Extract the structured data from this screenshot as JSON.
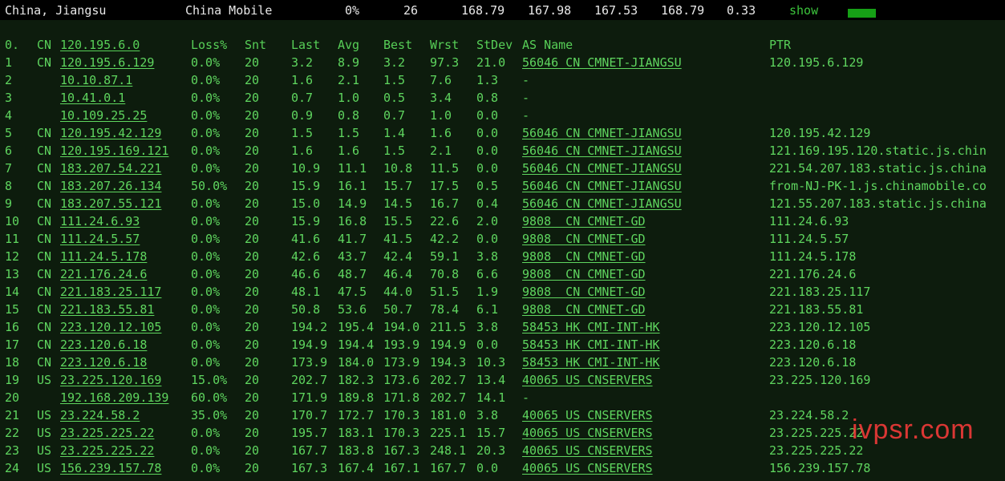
{
  "summary": {
    "location": "China, Jiangsu",
    "isp": "China Mobile",
    "loss": "0%",
    "sent": "26",
    "last": "168.79",
    "avg": "167.98",
    "best": "167.53",
    "worst": "168.79",
    "stdev": "0.33",
    "show_label": "show"
  },
  "headers": {
    "num": "0.",
    "cc": "CN",
    "ip": "120.195.6.0",
    "loss": "Loss%",
    "snt": "Snt",
    "last": "Last",
    "avg": "Avg",
    "best": "Best",
    "wrst": "Wrst",
    "stdev": "StDev",
    "as": "AS Name",
    "ptr": "PTR"
  },
  "hops": [
    {
      "num": "1",
      "cc": "CN",
      "ip": "120.195.6.129",
      "loss": "0.0%",
      "snt": "20",
      "last": "3.2",
      "avg": "8.9",
      "best": "3.2",
      "wrst": "97.3",
      "stdev": "21.0",
      "as": "56046 CN CMNET-JIANGSU",
      "ptr": "120.195.6.129"
    },
    {
      "num": "2",
      "cc": "",
      "ip": "10.10.87.1",
      "loss": "0.0%",
      "snt": "20",
      "last": "1.6",
      "avg": "2.1",
      "best": "1.5",
      "wrst": "7.6",
      "stdev": "1.3",
      "as": "-",
      "ptr": ""
    },
    {
      "num": "3",
      "cc": "",
      "ip": "10.41.0.1",
      "loss": "0.0%",
      "snt": "20",
      "last": "0.7",
      "avg": "1.0",
      "best": "0.5",
      "wrst": "3.4",
      "stdev": "0.8",
      "as": "-",
      "ptr": ""
    },
    {
      "num": "4",
      "cc": "",
      "ip": "10.109.25.25",
      "loss": "0.0%",
      "snt": "20",
      "last": "0.9",
      "avg": "0.8",
      "best": "0.7",
      "wrst": "1.0",
      "stdev": "0.0",
      "as": "-",
      "ptr": ""
    },
    {
      "num": "5",
      "cc": "CN",
      "ip": "120.195.42.129",
      "loss": "0.0%",
      "snt": "20",
      "last": "1.5",
      "avg": "1.5",
      "best": "1.4",
      "wrst": "1.6",
      "stdev": "0.0",
      "as": "56046 CN CMNET-JIANGSU",
      "ptr": "120.195.42.129"
    },
    {
      "num": "6",
      "cc": "CN",
      "ip": "120.195.169.121",
      "loss": "0.0%",
      "snt": "20",
      "last": "1.6",
      "avg": "1.6",
      "best": "1.5",
      "wrst": "2.1",
      "stdev": "0.0",
      "as": "56046 CN CMNET-JIANGSU",
      "ptr": "121.169.195.120.static.js.chin"
    },
    {
      "num": "7",
      "cc": "CN",
      "ip": "183.207.54.221",
      "loss": "0.0%",
      "snt": "20",
      "last": "10.9",
      "avg": "11.1",
      "best": "10.8",
      "wrst": "11.5",
      "stdev": "0.0",
      "as": "56046 CN CMNET-JIANGSU",
      "ptr": "221.54.207.183.static.js.china"
    },
    {
      "num": "8",
      "cc": "CN",
      "ip": "183.207.26.134",
      "loss": "50.0%",
      "snt": "20",
      "last": "15.9",
      "avg": "16.1",
      "best": "15.7",
      "wrst": "17.5",
      "stdev": "0.5",
      "as": "56046 CN CMNET-JIANGSU",
      "ptr": "from-NJ-PK-1.js.chinamobile.co"
    },
    {
      "num": "9",
      "cc": "CN",
      "ip": "183.207.55.121",
      "loss": "0.0%",
      "snt": "20",
      "last": "15.0",
      "avg": "14.9",
      "best": "14.5",
      "wrst": "16.7",
      "stdev": "0.4",
      "as": "56046 CN CMNET-JIANGSU",
      "ptr": "121.55.207.183.static.js.china"
    },
    {
      "num": "10",
      "cc": "CN",
      "ip": "111.24.6.93",
      "loss": "0.0%",
      "snt": "20",
      "last": "15.9",
      "avg": "16.8",
      "best": "15.5",
      "wrst": "22.6",
      "stdev": "2.0",
      "as": "9808  CN CMNET-GD",
      "ptr": "111.24.6.93"
    },
    {
      "num": "11",
      "cc": "CN",
      "ip": "111.24.5.57",
      "loss": "0.0%",
      "snt": "20",
      "last": "41.6",
      "avg": "41.7",
      "best": "41.5",
      "wrst": "42.2",
      "stdev": "0.0",
      "as": "9808  CN CMNET-GD",
      "ptr": "111.24.5.57"
    },
    {
      "num": "12",
      "cc": "CN",
      "ip": "111.24.5.178",
      "loss": "0.0%",
      "snt": "20",
      "last": "42.6",
      "avg": "43.7",
      "best": "42.4",
      "wrst": "59.1",
      "stdev": "3.8",
      "as": "9808  CN CMNET-GD",
      "ptr": "111.24.5.178"
    },
    {
      "num": "13",
      "cc": "CN",
      "ip": "221.176.24.6",
      "loss": "0.0%",
      "snt": "20",
      "last": "46.6",
      "avg": "48.7",
      "best": "46.4",
      "wrst": "70.8",
      "stdev": "6.6",
      "as": "9808  CN CMNET-GD",
      "ptr": "221.176.24.6"
    },
    {
      "num": "14",
      "cc": "CN",
      "ip": "221.183.25.117",
      "loss": "0.0%",
      "snt": "20",
      "last": "48.1",
      "avg": "47.5",
      "best": "44.0",
      "wrst": "51.5",
      "stdev": "1.9",
      "as": "9808  CN CMNET-GD",
      "ptr": "221.183.25.117"
    },
    {
      "num": "15",
      "cc": "CN",
      "ip": "221.183.55.81",
      "loss": "0.0%",
      "snt": "20",
      "last": "50.8",
      "avg": "53.6",
      "best": "50.7",
      "wrst": "78.4",
      "stdev": "6.1",
      "as": "9808  CN CMNET-GD",
      "ptr": "221.183.55.81"
    },
    {
      "num": "16",
      "cc": "CN",
      "ip": "223.120.12.105",
      "loss": "0.0%",
      "snt": "20",
      "last": "194.2",
      "avg": "195.4",
      "best": "194.0",
      "wrst": "211.5",
      "stdev": "3.8",
      "as": "58453 HK CMI-INT-HK",
      "ptr": "223.120.12.105"
    },
    {
      "num": "17",
      "cc": "CN",
      "ip": "223.120.6.18",
      "loss": "0.0%",
      "snt": "20",
      "last": "194.9",
      "avg": "194.4",
      "best": "193.9",
      "wrst": "194.9",
      "stdev": "0.0",
      "as": "58453 HK CMI-INT-HK",
      "ptr": "223.120.6.18"
    },
    {
      "num": "18",
      "cc": "CN",
      "ip": "223.120.6.18",
      "loss": "0.0%",
      "snt": "20",
      "last": "173.9",
      "avg": "184.0",
      "best": "173.9",
      "wrst": "194.3",
      "stdev": "10.3",
      "as": "58453 HK CMI-INT-HK",
      "ptr": "223.120.6.18"
    },
    {
      "num": "19",
      "cc": "US",
      "ip": "23.225.120.169",
      "loss": "15.0%",
      "snt": "20",
      "last": "202.7",
      "avg": "182.3",
      "best": "173.6",
      "wrst": "202.7",
      "stdev": "13.4",
      "as": "40065 US CNSERVERS",
      "ptr": "23.225.120.169"
    },
    {
      "num": "20",
      "cc": "",
      "ip": "192.168.209.139",
      "loss": "60.0%",
      "snt": "20",
      "last": "171.9",
      "avg": "189.8",
      "best": "171.8",
      "wrst": "202.7",
      "stdev": "14.1",
      "as": "-",
      "ptr": ""
    },
    {
      "num": "21",
      "cc": "US",
      "ip": "23.224.58.2",
      "loss": "35.0%",
      "snt": "20",
      "last": "170.7",
      "avg": "172.7",
      "best": "170.3",
      "wrst": "181.0",
      "stdev": "3.8",
      "as": "40065 US CNSERVERS",
      "ptr": "23.224.58.2"
    },
    {
      "num": "22",
      "cc": "US",
      "ip": "23.225.225.22",
      "loss": "0.0%",
      "snt": "20",
      "last": "195.7",
      "avg": "183.1",
      "best": "170.3",
      "wrst": "225.1",
      "stdev": "15.7",
      "as": "40065 US CNSERVERS",
      "ptr": "23.225.225.22"
    },
    {
      "num": "23",
      "cc": "US",
      "ip": "23.225.225.22",
      "loss": "0.0%",
      "snt": "20",
      "last": "167.7",
      "avg": "183.8",
      "best": "167.3",
      "wrst": "248.1",
      "stdev": "20.3",
      "as": "40065 US CNSERVERS",
      "ptr": "23.225.225.22"
    },
    {
      "num": "24",
      "cc": "US",
      "ip": "156.239.157.78",
      "loss": "0.0%",
      "snt": "20",
      "last": "167.3",
      "avg": "167.4",
      "best": "167.1",
      "wrst": "167.7",
      "stdev": "0.0",
      "as": "40065 US CNSERVERS",
      "ptr": "156.239.157.78"
    }
  ],
  "watermark": "ivpsr.com",
  "colors": {
    "background": "#0d1c0d",
    "text": "#5fd65f",
    "header_bg": "#000000",
    "header_text": "#e8e8e8",
    "show_bar": "#16a016",
    "watermark": "#ff3c3c"
  }
}
